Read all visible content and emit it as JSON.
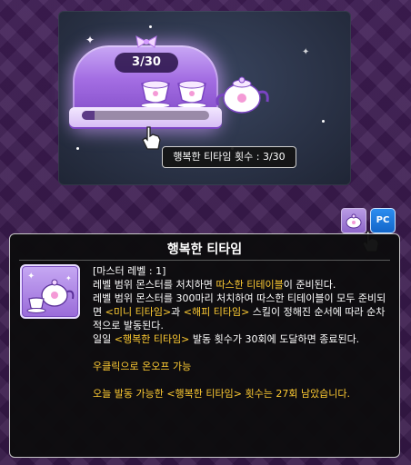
{
  "preview": {
    "counter": "3/30",
    "tooltip": "행복한 티타임 횟수 : 3/30",
    "progress_fraction": 0.1
  },
  "icons": {
    "pc_badge": "PC"
  },
  "tooltip": {
    "title": "행복한 티타임",
    "master_level": "[마스터 레벨 : 1]",
    "line1_pre": "레벨 범위 몬스터를 처치하면 ",
    "line1_hl": "따스한 티테이블",
    "line1_post": "이 준비된다.",
    "line2": "레벨 범위 몬스터를 300마리 처치하여 따스한 티테이블이 모두 준비되면 ",
    "line2_hl1": "<미니 티타임>",
    "line2_mid": "과 ",
    "line2_hl2": "<해피 티타임>",
    "line2_post": " 스킬이 정해진 순서에 따라 순차적으로 발동된다.",
    "line3_pre": "일일 ",
    "line3_hl": "<행복한 티타임>",
    "line3_post": " 발동 횟수가 30회에 도달하면 종료된다.",
    "toggle_text": "우클릭으로 온오프 가능",
    "remaining_pre": "오늘 발동 가능한 <행복한 티타임> 횟수는 27회 남았습니다."
  },
  "colors": {
    "highlight": "#ffcc33",
    "accent_purple": "#a46ee3",
    "pc_blue": "#1f7ae0"
  }
}
